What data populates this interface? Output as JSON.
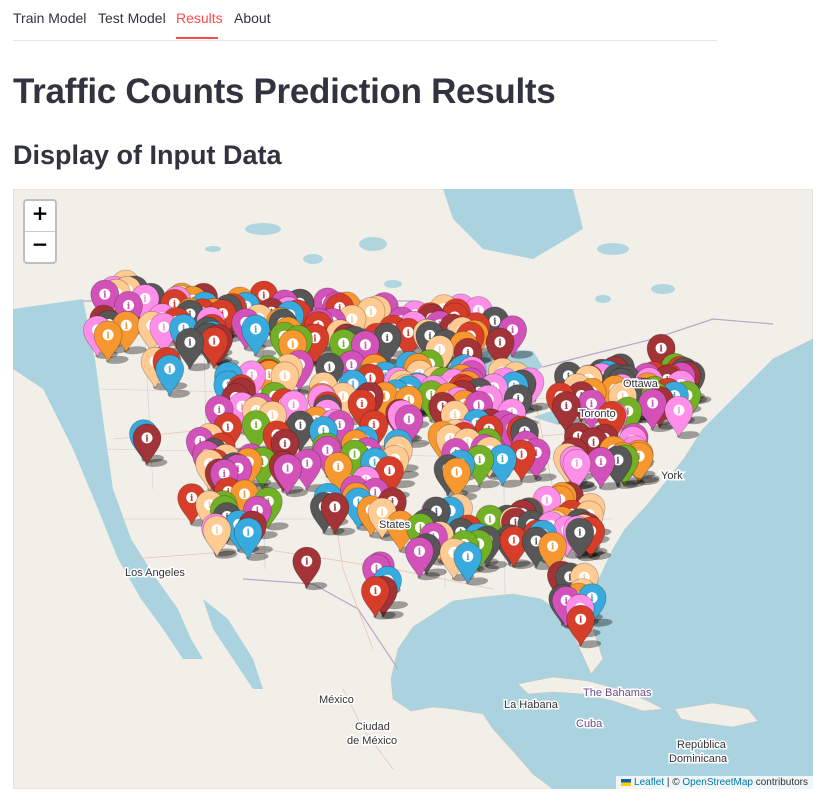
{
  "nav": {
    "tabs": [
      {
        "label": "Train Model",
        "active": false
      },
      {
        "label": "Test Model",
        "active": false
      },
      {
        "label": "Results",
        "active": true
      },
      {
        "label": "About",
        "active": false
      }
    ],
    "active_color": "#ff4b4b"
  },
  "page": {
    "title": "Traffic Counts Prediction Results",
    "subtitle": "Display of Input Data"
  },
  "map": {
    "zoom_in": "+",
    "zoom_out": "−",
    "place_labels": {
      "ottawa": "Ottawa",
      "toronto": "Toronto",
      "york": "York",
      "los_angeles": "Los Angeles",
      "states": "States",
      "mexico": "México",
      "ciudad": "Ciudad",
      "de_mexico": "de México",
      "la_habana": "La Habana",
      "the_bahamas": "The Bahamas",
      "cuba": "Cuba",
      "republica": "República",
      "dominicana": "Dominicana"
    },
    "marker_icon": "info-icon",
    "marker_colors": [
      "#d63e2a",
      "#38aadd",
      "#72b026",
      "#f69730",
      "#d252b9",
      "#575757",
      "#ff8ee9",
      "#ffcb92",
      "#a23336"
    ],
    "attribution": {
      "leaflet": "Leaflet",
      "separator": "| ©",
      "osm": "OpenStreetMap",
      "contributors": "contributors"
    }
  }
}
